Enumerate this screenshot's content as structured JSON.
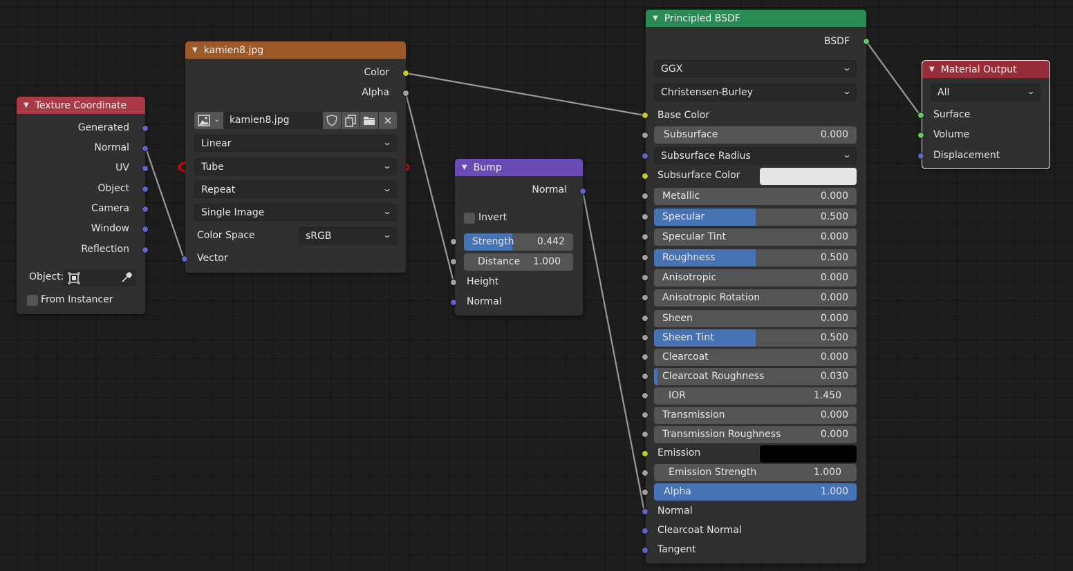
{
  "texture_coordinate": {
    "title": "Texture Coordinate",
    "outputs": [
      "Generated",
      "Normal",
      "UV",
      "Object",
      "Camera",
      "Window",
      "Reflection"
    ],
    "object_label": "Object:",
    "from_instancer": "From Instancer"
  },
  "image_texture": {
    "title": "kamien8.jpg",
    "outputs": [
      "Color",
      "Alpha"
    ],
    "image_name": "kamien8.jpg",
    "interpolation": "Linear",
    "projection": "Tube",
    "extension": "Repeat",
    "source": "Single Image",
    "color_space_label": "Color Space",
    "color_space_value": "sRGB",
    "input_vector": "Vector"
  },
  "bump": {
    "title": "Bump",
    "output": "Normal",
    "invert": "Invert",
    "strength_label": "Strength",
    "strength_value": "0.442",
    "strength_fraction": 0.442,
    "distance_label": "Distance",
    "distance_value": "1.000",
    "height": "Height",
    "normal": "Normal"
  },
  "principled": {
    "title": "Principled BSDF",
    "output": "BSDF",
    "distribution": "GGX",
    "subsurface_method": "Christensen-Burley",
    "base_color": "Base Color",
    "subsurface_label": "Subsurface",
    "subsurface_value": "0.000",
    "subsurface_radius": "Subsurface Radius",
    "subsurface_color": "Subsurface Color",
    "subsurface_color_hex": "#e5e5e5",
    "fields": [
      {
        "label": "Metallic",
        "value": "0.000",
        "fraction": 0
      },
      {
        "label": "Specular",
        "value": "0.500",
        "fraction": 0.5
      },
      {
        "label": "Specular Tint",
        "value": "0.000",
        "fraction": 0
      },
      {
        "label": "Roughness",
        "value": "0.500",
        "fraction": 0.5
      },
      {
        "label": "Anisotropic",
        "value": "0.000",
        "fraction": 0
      },
      {
        "label": "Anisotropic Rotation",
        "value": "0.000",
        "fraction": 0
      },
      {
        "label": "Sheen",
        "value": "0.000",
        "fraction": 0
      },
      {
        "label": "Sheen Tint",
        "value": "0.500",
        "fraction": 0.5
      },
      {
        "label": "Clearcoat",
        "value": "0.000",
        "fraction": 0
      },
      {
        "label": "Clearcoat Roughness",
        "value": "0.030",
        "fraction": 0.03
      },
      {
        "label": "IOR",
        "value": "1.450",
        "fraction": 0
      },
      {
        "label": "Transmission",
        "value": "0.000",
        "fraction": 0
      },
      {
        "label": "Transmission Roughness",
        "value": "0.000",
        "fraction": 0
      }
    ],
    "emission": "Emission",
    "emission_color_hex": "#000000",
    "emission_strength_label": "Emission Strength",
    "emission_strength_value": "1.000",
    "alpha_label": "Alpha",
    "alpha_value": "1.000",
    "alpha_fraction": 1,
    "normal": "Normal",
    "clearcoat_normal": "Clearcoat Normal",
    "tangent": "Tangent"
  },
  "material_output": {
    "title": "Material Output",
    "target": "All",
    "inputs": [
      "Surface",
      "Volume",
      "Displacement"
    ]
  },
  "colors": {
    "header_input": "#ab3a49",
    "header_texture": "#9c5a2b",
    "header_vector": "#6a4bb3",
    "header_shader": "#2a8c54",
    "header_output": "#972d38",
    "slider_fill": "#4772b3",
    "annotation": "#e00000"
  }
}
